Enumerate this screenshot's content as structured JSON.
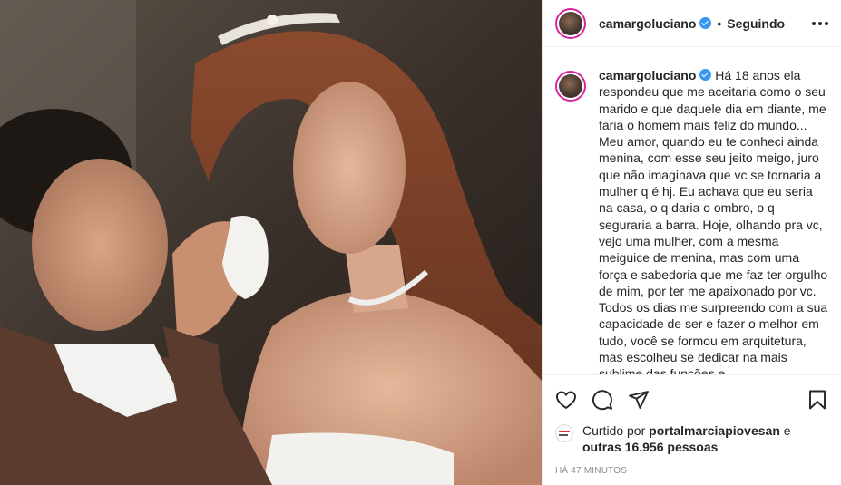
{
  "post": {
    "image_alt": "Wedding photo",
    "account": {
      "username": "camargoluciano",
      "verified": true
    },
    "header": {
      "separator": "•",
      "follow_status": "Seguindo"
    },
    "caption": {
      "username": "camargoluciano",
      "text": "Há 18 anos ela respondeu que me aceitaria como o seu marido e que daquele dia em diante, me faria o homem mais feliz do mundo... Meu amor, quando eu te conheci ainda menina, com esse seu jeito meigo, juro que não imaginava que vc se tornaria a mulher q é hj. Eu achava que eu seria na casa, o q daria o ombro, o q seguraria a barra. Hoje, olhando pra vc, vejo uma mulher, com a mesma meiguice de menina, mas com uma força e sabedoria que me faz ter orgulho de mim, por ter me apaixonado por vc. Todos os dias me surpreendo com a sua capacidade de ser e fazer o melhor em tudo, você se formou em arquitetura, mas escolheu se dedicar na mais sublime das funções e"
    },
    "actions": {
      "like_icon": "heart-icon",
      "comment_icon": "comment-icon",
      "share_icon": "paper-plane-icon",
      "save_icon": "bookmark-icon"
    },
    "likes": {
      "prefix": "Curtido por",
      "first_user": "portalmarciapiovesan",
      "middle": "e",
      "others": "outras 16.956 pessoas"
    },
    "timestamp": "Há 47 minutos"
  },
  "colors": {
    "verified_badge": "#3897f0",
    "text": "#262626",
    "muted": "#8e8e8e",
    "border": "#efefef"
  }
}
